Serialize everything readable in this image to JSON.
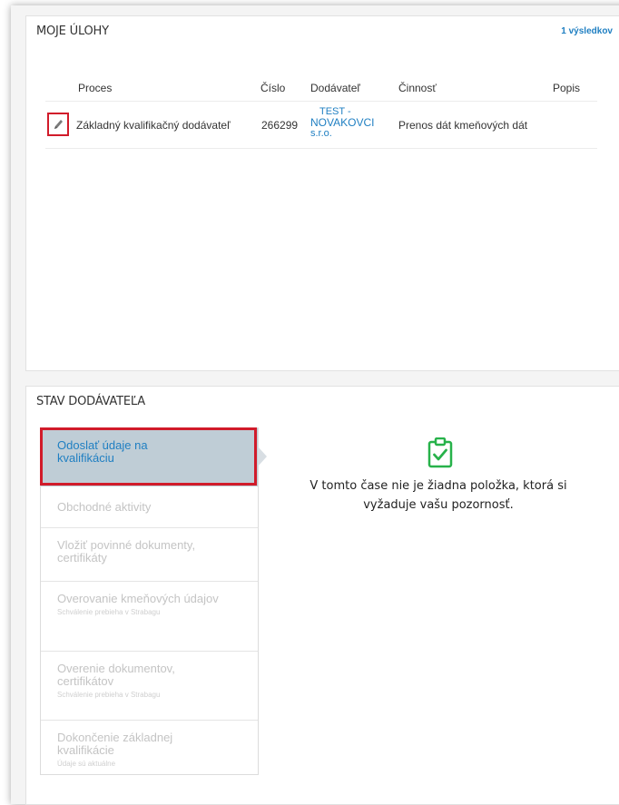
{
  "tasks_panel": {
    "title": "MOJE ÚLOHY",
    "results_link": "1 výsledkov",
    "columns": [
      "Proces",
      "Číslo",
      "Dodávateľ",
      "Činnosť",
      "Popis"
    ],
    "rows": [
      {
        "process": "Základný kvalifikačný dodávateľ",
        "number": "266299",
        "supplier_lines": [
          "TEST -",
          "NOVAKOVCI",
          "s.r.o."
        ],
        "activity": "Prenos dát kmeňových dát",
        "description": ""
      }
    ],
    "edit_icon": "pencil-icon"
  },
  "status_panel": {
    "title": "STAV DODÁVATEĽA",
    "steps": [
      {
        "label": "Odoslať údaje na kvalifikáciu",
        "sub": "",
        "active": true
      },
      {
        "label": "Obchodné aktivity",
        "sub": ""
      },
      {
        "label": "Vložiť povinné dokumenty, certifikáty",
        "sub": ""
      },
      {
        "label": "Overovanie kmeňových údajov",
        "sub": "Schválenie prebieha v Strabagu"
      },
      {
        "label": "Overenie dokumentov, certifikátov",
        "sub": "Schválenie prebieha v Strabagu"
      },
      {
        "label": "Dokončenie základnej kvalifikácie",
        "sub": "Údaje sú aktuálne"
      }
    ],
    "message_icon": "clipboard-check-icon",
    "message": "V tomto čase nie je žiadna položka, ktorá si vyžaduje vašu pozornosť."
  },
  "colors": {
    "accent": "#1f7fc2",
    "highlight": "#d11b2a",
    "active_step_bg": "#bfcdd6",
    "check_green": "#27b24a"
  }
}
